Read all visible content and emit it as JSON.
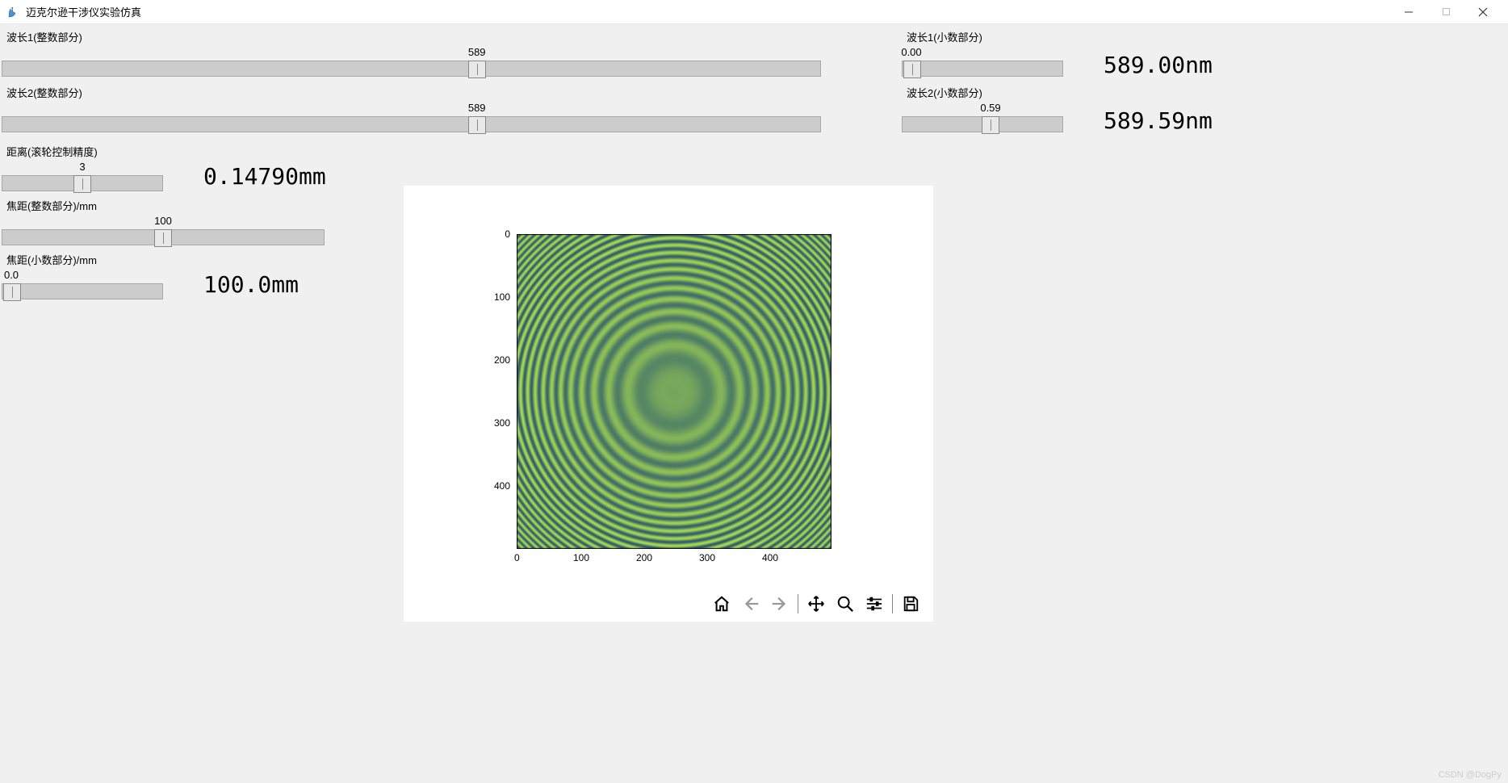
{
  "window": {
    "title": "迈克尔逊干涉仪实验仿真"
  },
  "sliders": {
    "wl1_int": {
      "label": "波长1(整数部分)",
      "value": "589",
      "pos": 58
    },
    "wl1_dec": {
      "label": "波长1(小数部分)",
      "value": "0.00",
      "pos": 6
    },
    "wl1_result": "589.00nm",
    "wl2_int": {
      "label": "波长2(整数部分)",
      "value": "589",
      "pos": 58
    },
    "wl2_dec": {
      "label": "波长2(小数部分)",
      "value": "0.59",
      "pos": 55
    },
    "wl2_result": "589.59nm",
    "dist": {
      "label": "距离(滚轮控制精度)",
      "value": "3",
      "pos": 50
    },
    "dist_result": "0.14790mm",
    "focal_int": {
      "label": "焦距(整数部分)/mm",
      "value": "100",
      "pos": 50
    },
    "focal_dec": {
      "label": "焦距(小数部分)/mm",
      "value": "0.0",
      "pos": 6
    },
    "focal_result": "100.0mm"
  },
  "plot": {
    "x_ticks": [
      "0",
      "100",
      "200",
      "300",
      "400"
    ],
    "y_ticks": [
      "0",
      "100",
      "200",
      "300",
      "400"
    ]
  },
  "toolbar": {
    "home": "home-icon",
    "back": "back-icon",
    "forward": "forward-icon",
    "pan": "pan-icon",
    "zoom": "zoom-icon",
    "config": "config-icon",
    "save": "save-icon"
  },
  "watermark": "CSDN @DogPy"
}
